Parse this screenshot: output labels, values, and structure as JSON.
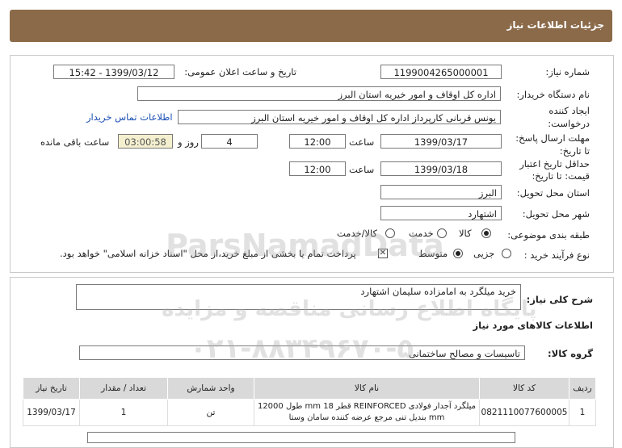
{
  "header": {
    "title": "جزئیات اطلاعات نیاز"
  },
  "form": {
    "need_number_label": "شماره نیاز:",
    "need_number": "1199004265000001",
    "announce_label": "تاریخ و ساعت اعلان عمومی:",
    "announce_value": "1399/03/12 - 15:42",
    "buyer_org_label": "نام دستگاه خریدار:",
    "buyer_org": "اداره کل اوقاف و امور خیریه استان البرز",
    "creator_label_1": "ایجاد کننده",
    "creator_label_2": "درخواست:",
    "creator": "یونس قربانی کارپرداز اداره کل اوقاف و امور خیریه استان البرز",
    "contact_link": "اطلاعات تماس خریدار",
    "deadline_label_1": "مهلت ارسال پاسخ:",
    "deadline_label_2": "تا تاریخ:",
    "deadline_date": "1399/03/17",
    "time_label": "ساعت",
    "deadline_time": "12:00",
    "days_value": "4",
    "days_label": "روز و",
    "remaining_time": "03:00:58",
    "remaining_label": "ساعت باقی مانده",
    "validity_label_1": "حداقل تاریخ اعتبار",
    "validity_label_2": "قیمت: تا تاریخ:",
    "validity_date": "1399/03/18",
    "validity_time": "12:00",
    "province_label": "استان محل تحویل:",
    "province": "البرز",
    "city_label": "شهر محل تحویل:",
    "city": "اشتهارد",
    "category_label": "طبقه بندی موضوعی:",
    "category_options": [
      "کالا",
      "خدمت",
      "کالا/خدمت"
    ],
    "process_label": "نوع فرآیند خرید :",
    "process_options": [
      "جزیی",
      "متوسط"
    ],
    "payment_note": "پرداخت تمام یا بخشی از مبلغ خرید،از محل \"اسناد خزانه اسلامی\" خواهد بود."
  },
  "details": {
    "summary_label": "شرح کلی نیاز:",
    "summary": "خرید میلگرد به امامزاده سلیمان اشتهارد",
    "goods_info_title": "اطلاعات کالاهای مورد نیاز",
    "group_label": "گروه کالا:",
    "group": "تاسیسات و مصالح ساختمانی",
    "table_headers": [
      "ردیف",
      "کد کالا",
      "نام کالا",
      "واحد شمارش",
      "تعداد / مقدار",
      "تاریخ نیاز"
    ],
    "rows": [
      {
        "row": "1",
        "code": "0821110077600005",
        "name_line1": "میلگرد آجدار فولادی REINFORCED قطر 18 mm طول 12000",
        "name_line2": "mm بندیل تنی مرجع عرضه کننده سامان وستا",
        "unit": "تن",
        "qty": "1",
        "date": "1399/03/17"
      }
    ]
  },
  "watermark": {
    "line1": "ParsNamadData",
    "line2": "پایگاه اطلاع رسانی مناقصه و مزایده",
    "line3": "۰۲۱-۸۸۳۴۹۶۷۰-۵"
  }
}
